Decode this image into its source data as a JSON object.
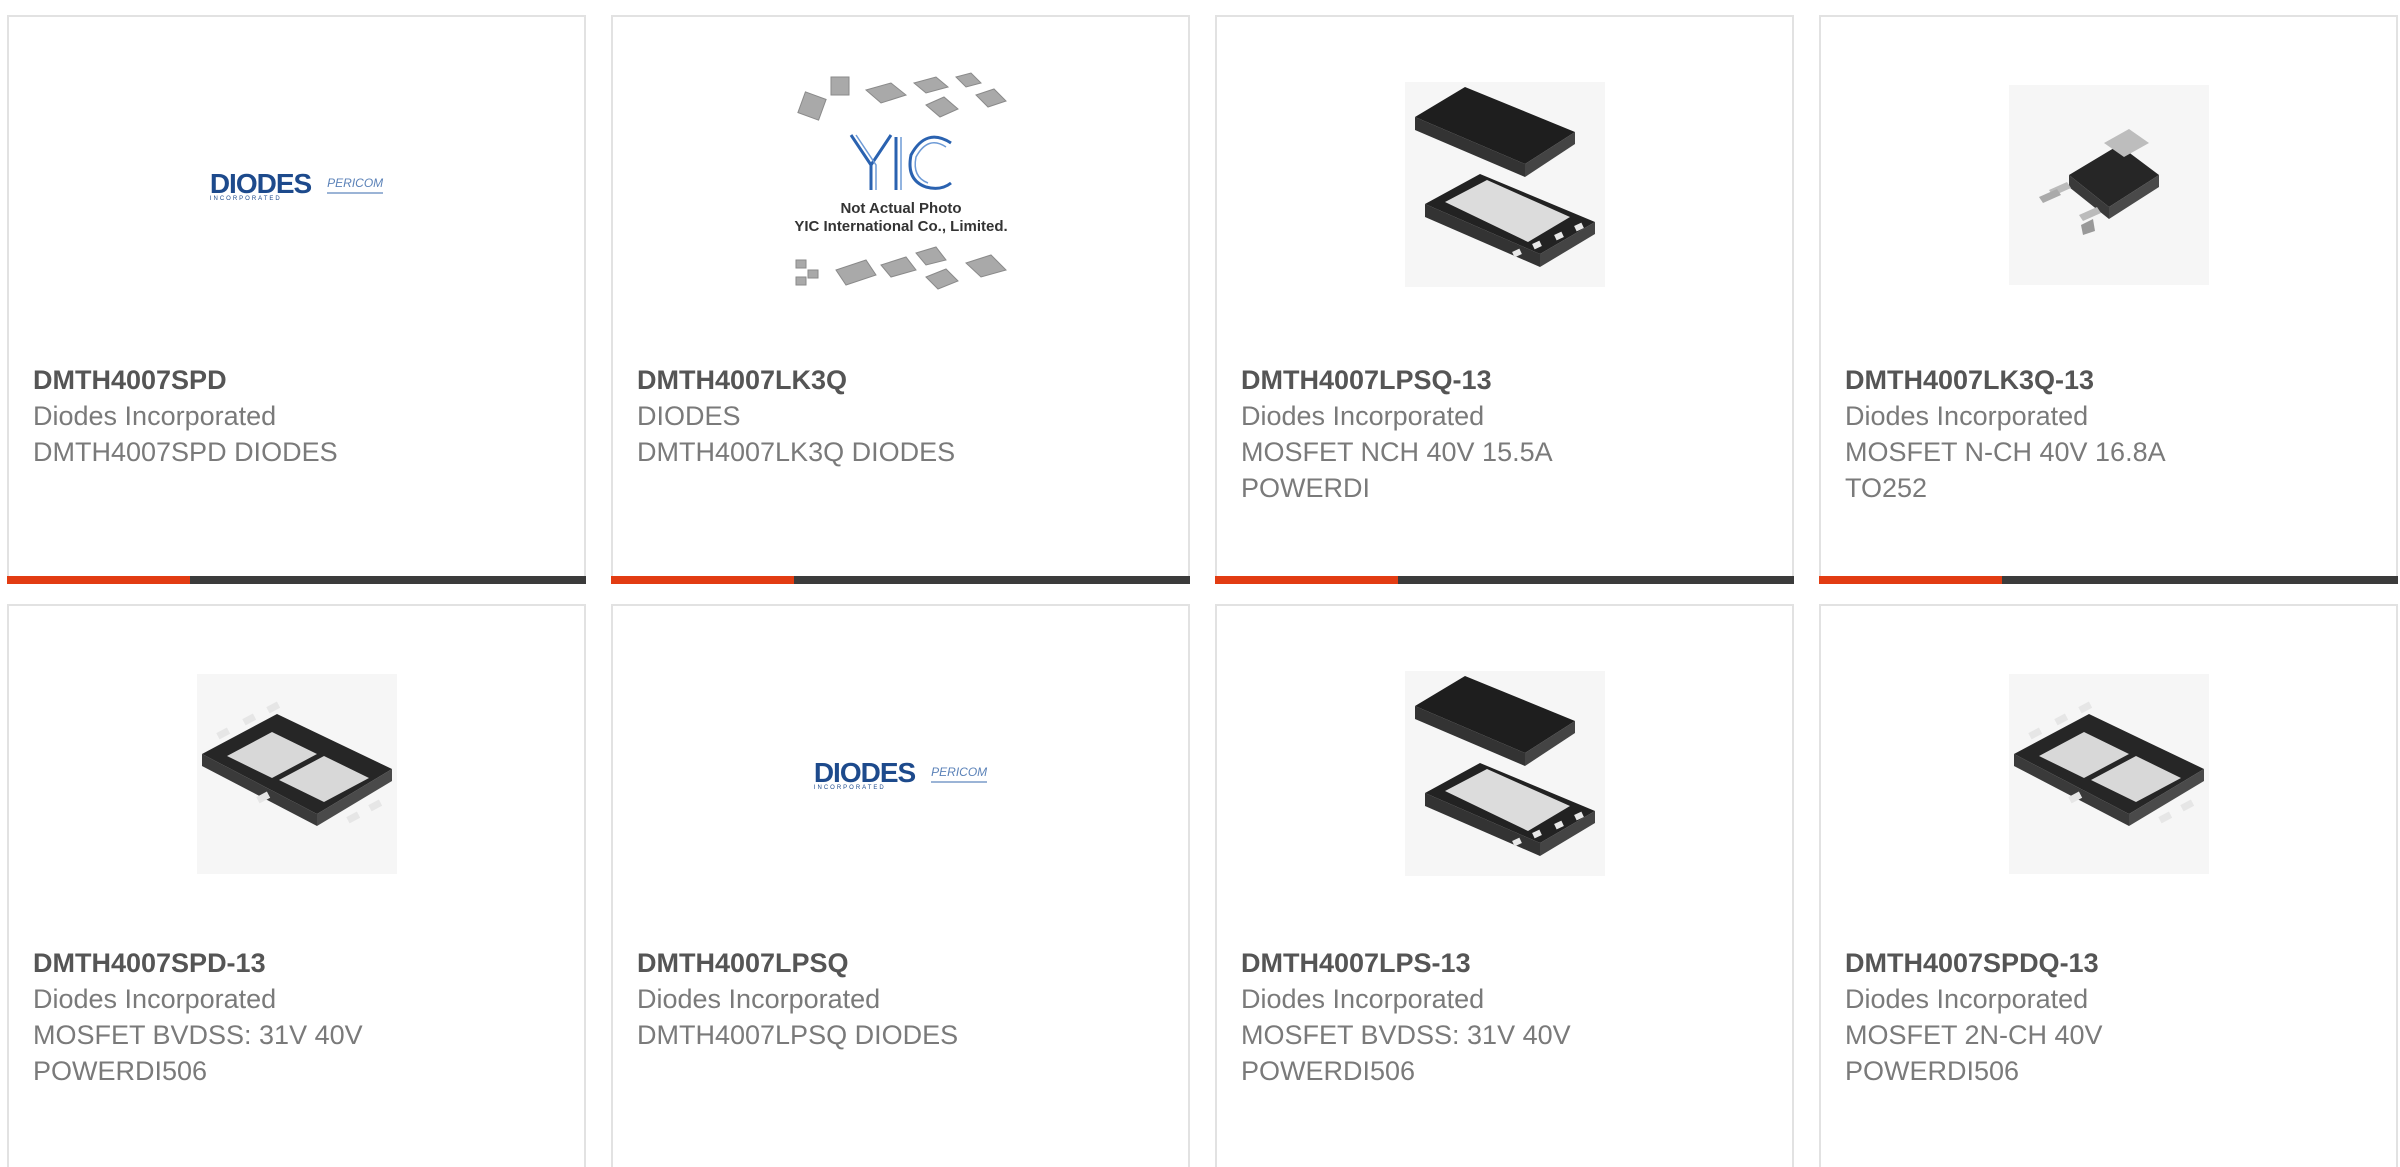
{
  "cards": [
    {
      "part": "DMTH4007SPD",
      "maker": "Diodes Incorporated",
      "desc1": "DMTH4007SPD DIODES",
      "desc2": "",
      "image": "diodes-pericom-logo"
    },
    {
      "part": "DMTH4007LK3Q",
      "maker": "DIODES",
      "desc1": "DMTH4007LK3Q DIODES",
      "desc2": "",
      "image": "yic-not-actual-photo",
      "yic_text_1": "Not Actual Photo",
      "yic_text_2": "YIC International Co., Limited."
    },
    {
      "part": "DMTH4007LPSQ-13",
      "maker": "Diodes Incorporated",
      "desc1": "MOSFET NCH 40V 15.5A",
      "desc2": "POWERDI",
      "image": "powerdi-package-pair"
    },
    {
      "part": "DMTH4007LK3Q-13",
      "maker": "Diodes Incorporated",
      "desc1": "MOSFET N-CH 40V 16.8A",
      "desc2": "TO252",
      "image": "to252-package"
    },
    {
      "part": "DMTH4007SPD-13",
      "maker": "Diodes Incorporated",
      "desc1": "MOSFET BVDSS: 31V 40V",
      "desc2": "POWERDI506",
      "image": "powerdi506-dual-package"
    },
    {
      "part": "DMTH4007LPSQ",
      "maker": "Diodes Incorporated",
      "desc1": "DMTH4007LPSQ DIODES",
      "desc2": "",
      "image": "diodes-pericom-logo"
    },
    {
      "part": "DMTH4007LPS-13",
      "maker": "Diodes Incorporated",
      "desc1": "MOSFET BVDSS: 31V 40V",
      "desc2": "POWERDI506",
      "image": "powerdi-package-pair"
    },
    {
      "part": "DMTH4007SPDQ-13",
      "maker": "Diodes Incorporated",
      "desc1": "MOSFET 2N-CH 40V",
      "desc2": "POWERDI506",
      "image": "powerdi506-dual-package"
    }
  ],
  "logo": {
    "diodes": "DIODES",
    "diodes_sub": "INCORPORATED",
    "pericom": "PERICOM"
  },
  "colors": {
    "accent": "#e23c12",
    "bar": "#3b3b3b",
    "border": "#e2e2e2",
    "text": "#7a7a7a",
    "part": "#555555"
  }
}
